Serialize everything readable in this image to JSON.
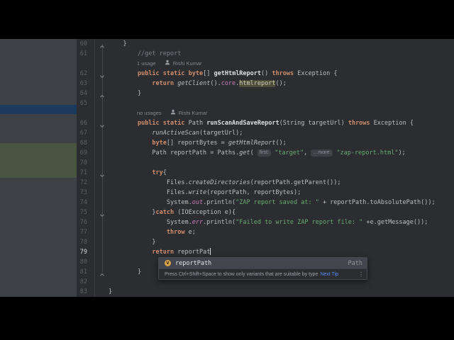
{
  "window": {
    "app": "IntelliJ IDEA editor (video frame, letterboxed)",
    "visible_line_range": {
      "first": 60,
      "last": 83
    }
  },
  "palette": {
    "letterbox": "#000000",
    "editor_bg": "#2b2d30",
    "panel_bg": "#3e4246",
    "panel_selection_blue": "#1b3a5e",
    "panel_vcs_green": "#4a5443",
    "line_number": "#5d6165",
    "current_line_number": "#d2d5da",
    "keyword": "#cf8e6d",
    "string": "#6aab73",
    "comment": "#7d8188",
    "field_purple": "#c77dbb",
    "usage_highlight_bg": "#4d4c38",
    "hint_chip_bg": "#3d4045",
    "popup_selected_bg": "#43464c",
    "link_blue": "#548af7",
    "variable_icon_bg": "#daa447"
  },
  "icons": {
    "person": "person-icon (author annotation)",
    "variable": "variable-icon (completion kind)",
    "fold_down": "chevron-down-icon",
    "fold_up": "chevron-up-icon",
    "kebab": "kebab-menu-icon"
  },
  "editor": {
    "rows": [
      {
        "n": "60",
        "fold": "up",
        "segs": [
          [
            "t",
            "    }"
          ]
        ]
      },
      {
        "n": "61",
        "segs": [
          [
            "c",
            "        //get report"
          ]
        ]
      },
      {
        "n": "",
        "ann": true,
        "usages": "1 usage",
        "author": "Rishi Kumar"
      },
      {
        "n": "62",
        "fold": "down",
        "segs": [
          [
            "t",
            "        "
          ],
          [
            "k",
            "public"
          ],
          [
            "t",
            " "
          ],
          [
            "k",
            "static"
          ],
          [
            "t",
            " "
          ],
          [
            "k",
            "byte"
          ],
          [
            "t",
            "[] "
          ],
          [
            "m",
            "getHtmlReport"
          ],
          [
            "t",
            "() "
          ],
          [
            "k",
            "throws"
          ],
          [
            "t",
            " Exception {"
          ]
        ]
      },
      {
        "n": "63",
        "segs": [
          [
            "t",
            "            "
          ],
          [
            "k",
            "return"
          ],
          [
            "t",
            " "
          ],
          [
            "i",
            "getClient"
          ],
          [
            "t",
            "()."
          ],
          [
            "f",
            "core"
          ],
          [
            "t",
            "."
          ],
          [
            "u",
            "htmlreport"
          ],
          [
            "t",
            "();"
          ]
        ]
      },
      {
        "n": "64",
        "fold": "up",
        "segs": [
          [
            "t",
            "        }"
          ]
        ]
      },
      {
        "n": "65",
        "segs": []
      },
      {
        "n": "",
        "ann": true,
        "usages": "no usages",
        "author": "Rishi Kumar"
      },
      {
        "n": "66",
        "fold": "down",
        "segs": [
          [
            "t",
            "        "
          ],
          [
            "k",
            "public"
          ],
          [
            "t",
            " "
          ],
          [
            "k",
            "static"
          ],
          [
            "t",
            " Path "
          ],
          [
            "m",
            "runScanAndSaveReport"
          ],
          [
            "t",
            "(String targetUrl) "
          ],
          [
            "k",
            "throws"
          ],
          [
            "t",
            " Exception {"
          ]
        ]
      },
      {
        "n": "67",
        "segs": [
          [
            "t",
            "            "
          ],
          [
            "i",
            "runActiveScan"
          ],
          [
            "t",
            "(targetUrl);"
          ]
        ]
      },
      {
        "n": "68",
        "segs": [
          [
            "t",
            "            "
          ],
          [
            "k",
            "byte"
          ],
          [
            "t",
            "[] reportBytes = "
          ],
          [
            "i",
            "getHtmlReport"
          ],
          [
            "t",
            "();"
          ]
        ]
      },
      {
        "n": "69",
        "segs": [
          [
            "t",
            "            Path reportPath = Paths."
          ],
          [
            "i",
            "get"
          ],
          [
            "t",
            "( "
          ],
          [
            "h",
            "first:"
          ],
          [
            "t",
            " "
          ],
          [
            "s",
            "\"target\""
          ],
          [
            "t",
            ", "
          ],
          [
            "h",
            "…more:"
          ],
          [
            "t",
            " "
          ],
          [
            "s",
            "\"zap-report.html\""
          ],
          [
            "t",
            ");"
          ]
        ]
      },
      {
        "n": "70",
        "segs": []
      },
      {
        "n": "71",
        "fold": "down",
        "segs": [
          [
            "t",
            "            "
          ],
          [
            "k",
            "try"
          ],
          [
            "t",
            "{"
          ]
        ]
      },
      {
        "n": "72",
        "segs": [
          [
            "t",
            "                Files."
          ],
          [
            "i",
            "createDirectories"
          ],
          [
            "t",
            "(reportPath.getParent());"
          ]
        ]
      },
      {
        "n": "73",
        "segs": [
          [
            "t",
            "                Files."
          ],
          [
            "i",
            "write"
          ],
          [
            "t",
            "(reportPath, reportBytes);"
          ]
        ]
      },
      {
        "n": "74",
        "segs": [
          [
            "t",
            "                System."
          ],
          [
            "fi",
            "out"
          ],
          [
            "t",
            ".println("
          ],
          [
            "s",
            "\"ZAP report saved at: \""
          ],
          [
            "t",
            " + reportPath.toAbsolutePath());"
          ]
        ]
      },
      {
        "n": "75",
        "fold": "down",
        "segs": [
          [
            "t",
            "            }"
          ],
          [
            "k",
            "catch"
          ],
          [
            "t",
            " (IOException e){"
          ]
        ]
      },
      {
        "n": "76",
        "segs": [
          [
            "t",
            "                System."
          ],
          [
            "fi",
            "err"
          ],
          [
            "t",
            ".println("
          ],
          [
            "s",
            "\"Failed to write ZAP report file: \""
          ],
          [
            "t",
            " +e.getMessage());"
          ]
        ]
      },
      {
        "n": "77",
        "segs": [
          [
            "t",
            "                "
          ],
          [
            "k",
            "throw"
          ],
          [
            "t",
            " e;"
          ]
        ]
      },
      {
        "n": "78",
        "segs": [
          [
            "t",
            "            }"
          ]
        ]
      },
      {
        "n": "79",
        "current": true,
        "caret": true,
        "segs": [
          [
            "t",
            "            "
          ],
          [
            "k",
            "return"
          ],
          [
            "t",
            " reportPat"
          ]
        ]
      },
      {
        "n": "80",
        "segs": []
      },
      {
        "n": "81",
        "fold": "up",
        "segs": [
          [
            "t",
            "        }"
          ]
        ]
      },
      {
        "n": "82",
        "segs": []
      },
      {
        "n": "83",
        "segs": [
          [
            "t",
            "}"
          ]
        ]
      }
    ]
  },
  "completion": {
    "item": {
      "icon_letter": "v",
      "label": "reportPath",
      "type": "Path"
    },
    "footer": {
      "text": "Press Ctrl+Shift+Space to show only variants that are suitable by type",
      "link": "Next Tip"
    }
  }
}
